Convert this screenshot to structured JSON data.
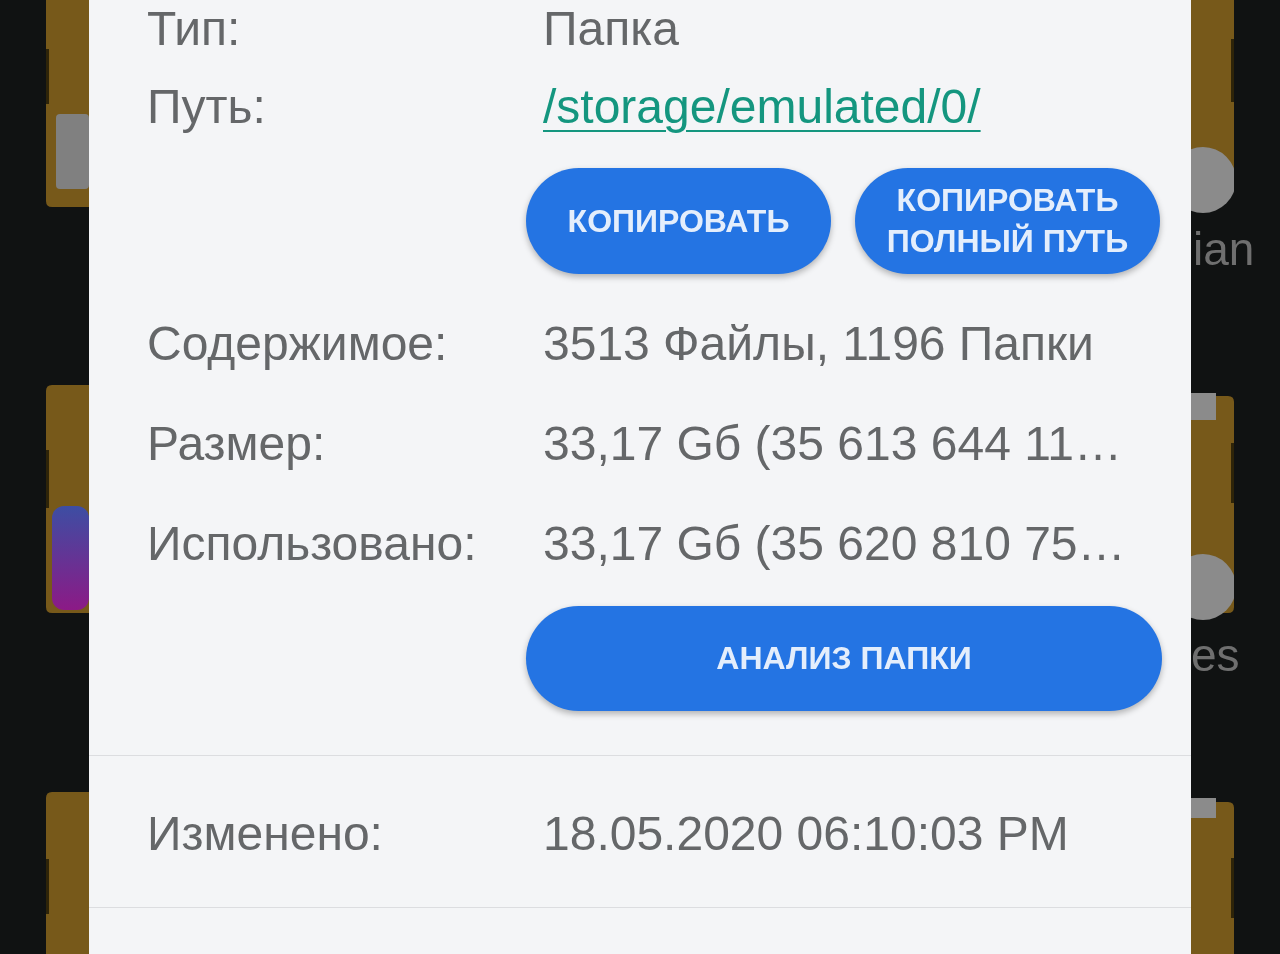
{
  "background": {
    "right_labels": [
      "ian",
      "es"
    ]
  },
  "dialog": {
    "properties": [
      {
        "kind": "text",
        "label": "Тип:",
        "value": "Папка"
      },
      {
        "kind": "link",
        "label": "Путь:",
        "value": "/storage/emulated/0/"
      }
    ],
    "path_buttons": [
      "КОПИРОВАТЬ",
      "КОПИРОВАТЬ ПОЛНЫЙ ПУТЬ"
    ],
    "details": [
      {
        "kind": "text",
        "label": "Содержимое:",
        "value": "3513 Файлы, 1196 Папки"
      },
      {
        "kind": "text",
        "label": "Размер:",
        "value": "33,17 Gб (35 613 644 11…"
      },
      {
        "kind": "text",
        "label": "Использовано:",
        "value": "33,17 Gб (35 620 810 75…"
      }
    ],
    "analyze_button": "АНАЛИЗ ПАПКИ",
    "modified": {
      "kind": "text",
      "label": "Изменено:",
      "value": "18.05.2020 06:10:03 PM"
    }
  }
}
